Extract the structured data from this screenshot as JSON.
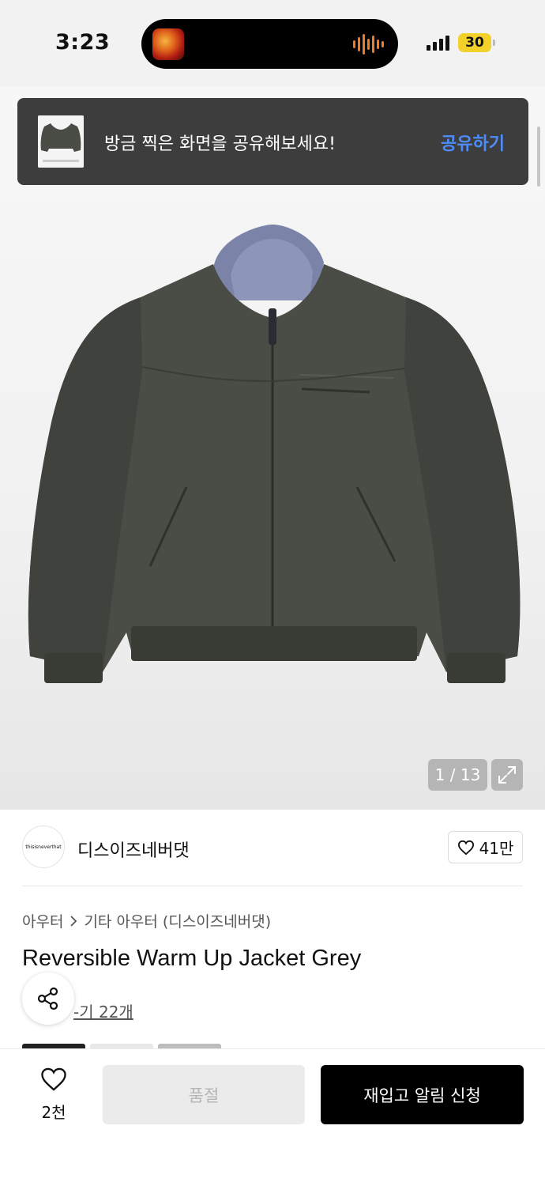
{
  "status_bar": {
    "time": "3:23",
    "battery": "30",
    "icons": [
      "now-playing-art-icon",
      "audio-wave-icon",
      "signal-icon",
      "battery-icon"
    ]
  },
  "toast": {
    "message": "방금 찍은 화면을 공유해보세요!",
    "action": "공유하기"
  },
  "gallery": {
    "counter": "1 / 13",
    "current": 1,
    "total": 13
  },
  "brand": {
    "logo_text": "thisisneverthat",
    "name": "디스이즈네버댓",
    "likes": "41만"
  },
  "breadcrumb": {
    "category": "아우터",
    "subcategory": "기타 아우터 (디스이즈네버댓)"
  },
  "product": {
    "title": "Reversible Warm Up Jacket Grey",
    "reviews": "-기 22개"
  },
  "bottom_bar": {
    "wish_count": "2천",
    "soldout_label": "품절",
    "restock_label": "재입고 알림 신청"
  },
  "colors": {
    "toast_bg": "#3d3d3d",
    "toast_action": "#4d8cff",
    "primary_button": "#000000",
    "disabled_button": "#ebebeb",
    "battery": "#f3d12b"
  }
}
